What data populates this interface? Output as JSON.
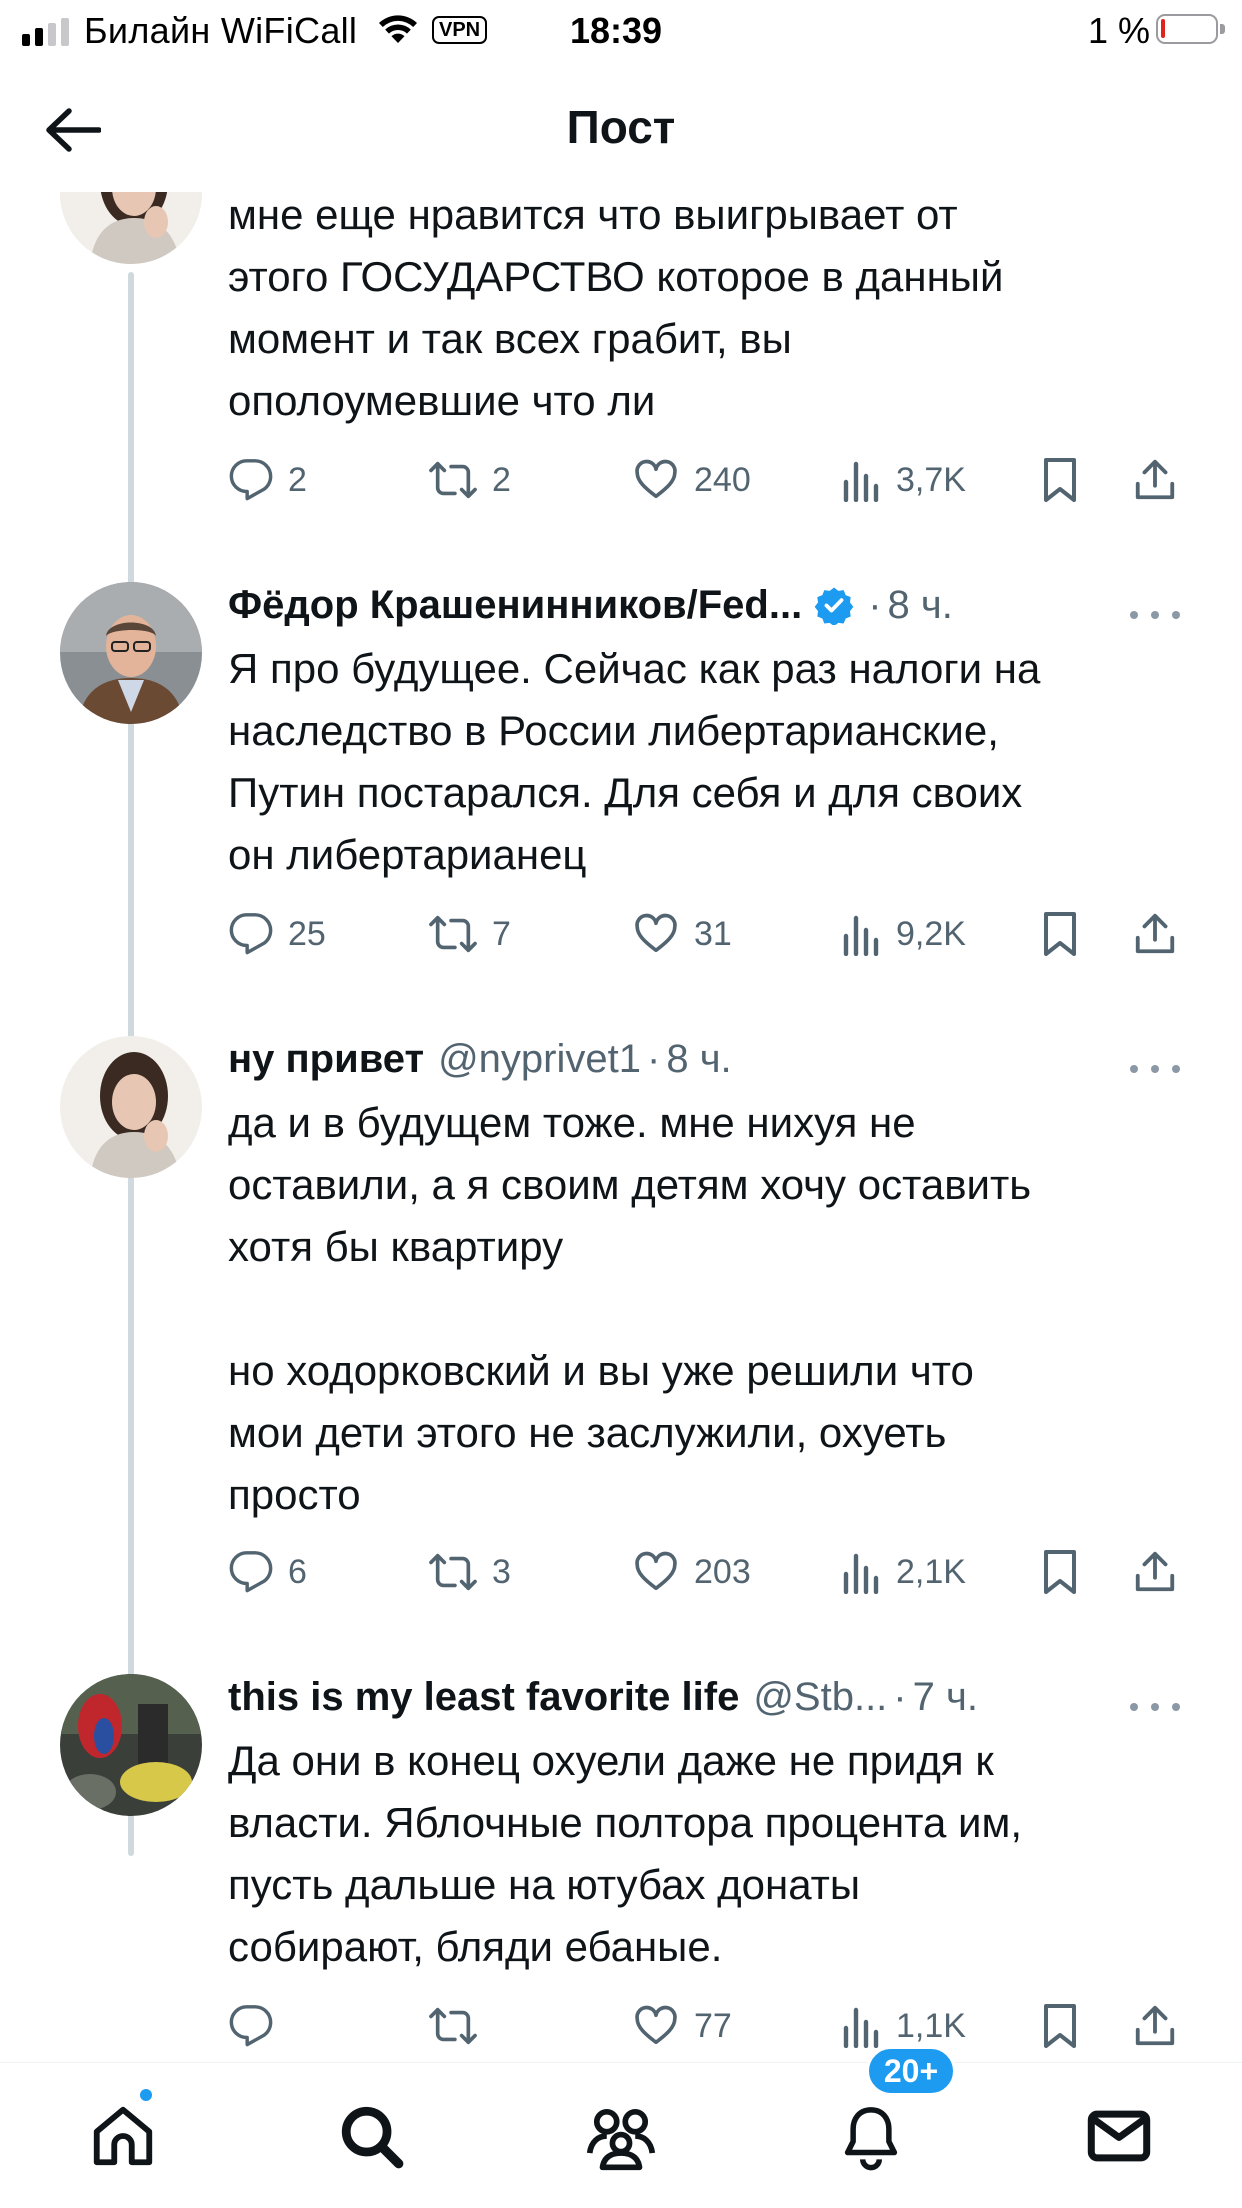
{
  "status_bar": {
    "carrier": "Билайн WiFiCall",
    "vpn": "VPN",
    "time": "18:39",
    "battery": "1 %",
    "battery_level_fraction": 0.01,
    "signal_bars_active": 2,
    "signal_bars_total": 4
  },
  "header": {
    "title": "Пост",
    "back_icon": "arrow-left-icon"
  },
  "tweets": [
    {
      "name": "",
      "handle": "",
      "time": "",
      "text": "мне еще нравится что выигрывает от\nэтого ГОСУДАРСТВО которое в данный\nмомент и так всех грабит, вы\nополоумевшие что ли",
      "replies": "2",
      "retweets": "2",
      "likes": "240",
      "views": "3,7K"
    },
    {
      "name": "Фёдор Крашенинников/Fed...",
      "handle": "",
      "dot": "·",
      "time": "8 ч.",
      "verified": true,
      "text": "Я про будущее. Сейчас как раз налоги на\nнаследство в России либертарианские,\nПутин постарался. Для себя и для своих\nон либертарианец",
      "replies": "25",
      "retweets": "7",
      "likes": "31",
      "views": "9,2K"
    },
    {
      "name": "ну привет",
      "handle": "@nyprivet1",
      "dot": "·",
      "time": "8 ч.",
      "text": "да и в будущем тоже. мне нихуя не\nоставили, а я своим детям хочу оставить\nхотя бы квартиру\n\nно ходорковский и вы уже решили что\nмои дети этого не заслужили, охуеть\nпросто",
      "replies": "6",
      "retweets": "3",
      "likes": "203",
      "views": "2,1K"
    },
    {
      "name": "this is my least favorite life",
      "handle": "@Stb...",
      "dot": "·",
      "time": "7 ч.",
      "text": "Да они в конец охуели даже не придя к\nвласти. Яблочные полтора процента им,\nпусть дальше на ютубах донаты\nсобирают, бляди ебаные.",
      "replies": "",
      "retweets": "",
      "likes": "77",
      "views": "1,1K"
    }
  ],
  "tabbar": {
    "items": [
      "home-icon",
      "search-icon",
      "communities-icon",
      "notifications-icon",
      "messages-icon"
    ],
    "notifications_badge": "20+"
  },
  "colors": {
    "accent": "#1d9bf0",
    "text_primary": "#0f1419",
    "text_secondary": "#536471",
    "thread_line": "#cfd9de"
  }
}
